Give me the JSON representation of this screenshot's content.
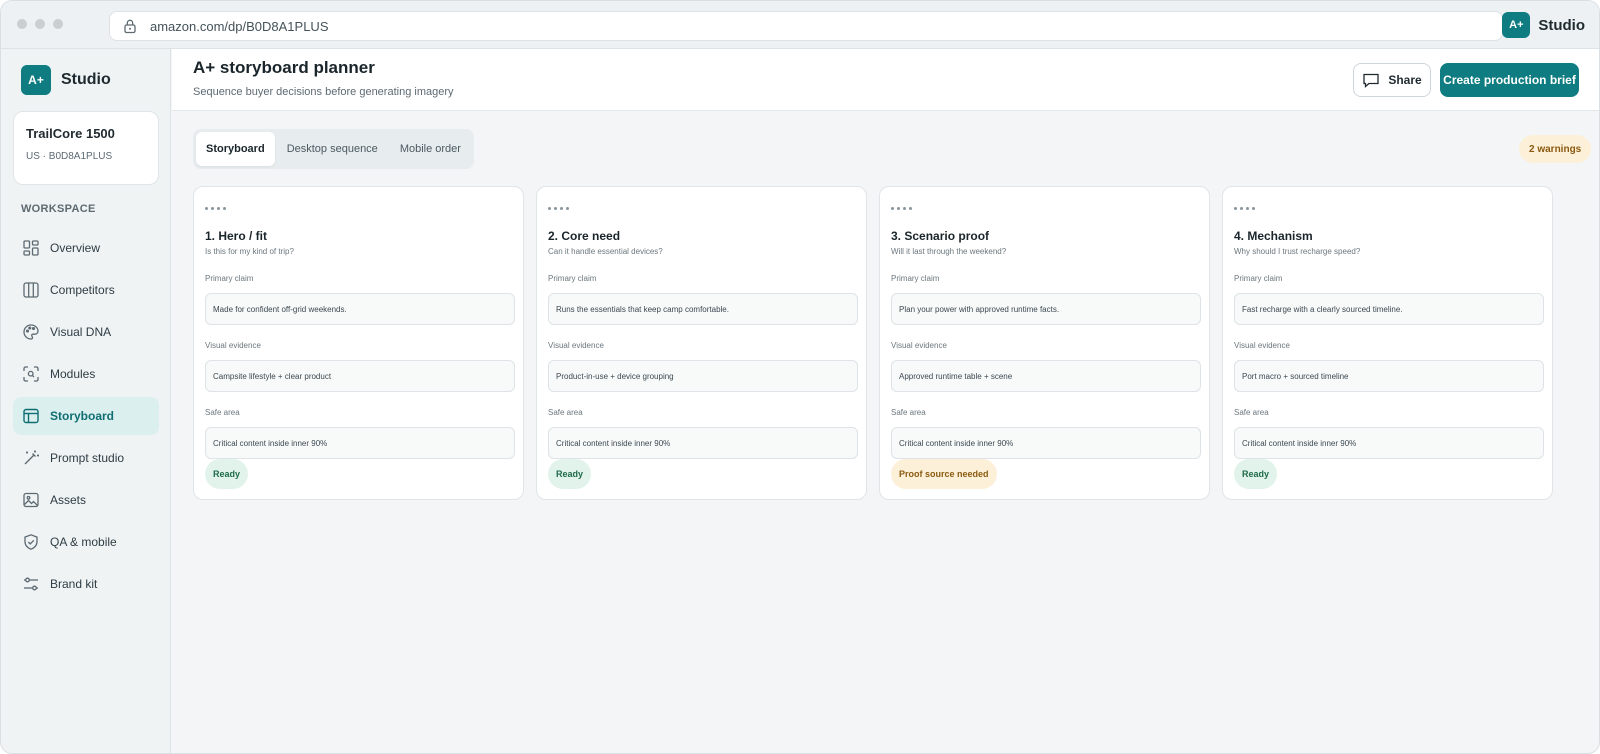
{
  "browser": {
    "url": "amazon.com/dp/B0D8A1PLUS",
    "brand_badge": "A+",
    "brand_name": "Studio"
  },
  "sidebar": {
    "brand_badge": "A+",
    "brand_name": "Studio",
    "product": {
      "name": "TrailCore 1500",
      "sub": "US · B0D8A1PLUS"
    },
    "section_label": "WORKSPACE",
    "items": [
      {
        "label": "Overview",
        "icon": "grid-icon"
      },
      {
        "label": "Competitors",
        "icon": "columns-icon"
      },
      {
        "label": "Visual DNA",
        "icon": "palette-icon"
      },
      {
        "label": "Modules",
        "icon": "scan-icon"
      },
      {
        "label": "Storyboard",
        "icon": "layout-icon",
        "active": true
      },
      {
        "label": "Prompt studio",
        "icon": "wand-icon"
      },
      {
        "label": "Assets",
        "icon": "image-icon"
      },
      {
        "label": "QA & mobile",
        "icon": "shield-icon"
      },
      {
        "label": "Brand kit",
        "icon": "sliders-icon"
      }
    ]
  },
  "header": {
    "title": "A+ storyboard planner",
    "subtitle": "Sequence buyer decisions before generating imagery",
    "share_label": "Share",
    "primary_label": "Create production brief"
  },
  "tabs": [
    {
      "label": "Storyboard",
      "active": true
    },
    {
      "label": "Desktop sequence"
    },
    {
      "label": "Mobile order"
    }
  ],
  "warnings_badge": "2 warnings",
  "field_labels": {
    "claim": "Primary claim",
    "evidence": "Visual evidence",
    "safe": "Safe area"
  },
  "cards": [
    {
      "title": "1. Hero / fit",
      "question": "Is this for my kind of trip?",
      "claim": "Made for confident off-grid weekends.",
      "evidence": "Campsite lifestyle + clear product",
      "safe": "Critical content inside inner 90%",
      "status": "Ready"
    },
    {
      "title": "2. Core need",
      "question": "Can it handle essential devices?",
      "claim": "Runs the essentials that keep camp comfortable.",
      "evidence": "Product-in-use + device grouping",
      "safe": "Critical content inside inner 90%",
      "status": "Ready"
    },
    {
      "title": "3. Scenario proof",
      "question": "Will it last through the weekend?",
      "claim": "Plan your power with approved runtime facts.",
      "evidence": "Approved runtime table + scene",
      "safe": "Critical content inside inner 90%",
      "status": "Proof source needed"
    },
    {
      "title": "4. Mechanism",
      "question": "Why should I trust recharge speed?",
      "claim": "Fast recharge with a clearly sourced timeline.",
      "evidence": "Port macro + sourced timeline",
      "safe": "Critical content inside inner 90%",
      "status": "Ready"
    }
  ],
  "colors": {
    "accent": "#0e7c80",
    "ready_bg": "#e2f3ec",
    "warn_bg": "#fdf0d8"
  }
}
